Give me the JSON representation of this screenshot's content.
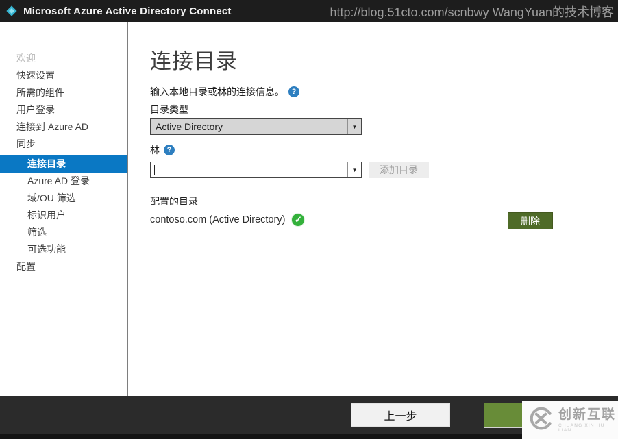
{
  "title_bar": {
    "app_title": "Microsoft Azure Active Directory Connect",
    "watermark": "http://blog.51cto.com/scnbwy WangYuan的技术博客",
    "close_glyph": "✕"
  },
  "sidebar": {
    "items": [
      {
        "label": "欢迎",
        "state": "disabled"
      },
      {
        "label": "快速设置",
        "state": "normal"
      },
      {
        "label": "所需的组件",
        "state": "normal"
      },
      {
        "label": "用户登录",
        "state": "normal"
      },
      {
        "label": "连接到 Azure AD",
        "state": "normal"
      },
      {
        "label": "同步",
        "state": "normal"
      },
      {
        "label": "连接目录",
        "state": "selected"
      },
      {
        "label": "Azure AD 登录",
        "state": "normal"
      },
      {
        "label": "域/OU 筛选",
        "state": "normal"
      },
      {
        "label": "标识用户",
        "state": "normal"
      },
      {
        "label": "筛选",
        "state": "normal"
      },
      {
        "label": "可选功能",
        "state": "normal"
      },
      {
        "label": "配置",
        "state": "normal"
      }
    ]
  },
  "main": {
    "page_title": "连接目录",
    "instruction": "输入本地目录或林的连接信息。",
    "help_glyph": "?",
    "directory_type": {
      "label": "目录类型",
      "selected_value": "Active Directory"
    },
    "forest": {
      "label": "林",
      "value": "",
      "add_button_label": "添加目录"
    },
    "configured": {
      "label": "配置的目录",
      "entries": [
        {
          "name": "contoso.com (Active Directory)",
          "status": "ok",
          "status_glyph": "✓",
          "delete_button_label": "删除"
        }
      ]
    }
  },
  "footer": {
    "previous_button_label": "上一步",
    "next_button_label": ""
  },
  "corner_badge": {
    "name": "创新互联",
    "subtext": "CHUANG XIN HU LIAN"
  },
  "colors": {
    "titlebar_bg": "#1d1d1d",
    "sidebar_selected_blue": "#0a78c4",
    "help_icon_blue": "#2e7fc0",
    "check_green": "#33b13b",
    "delete_button_green": "#4f6b28",
    "next_button_green": "#688c38",
    "footer_bg": "#2b2b2b"
  }
}
